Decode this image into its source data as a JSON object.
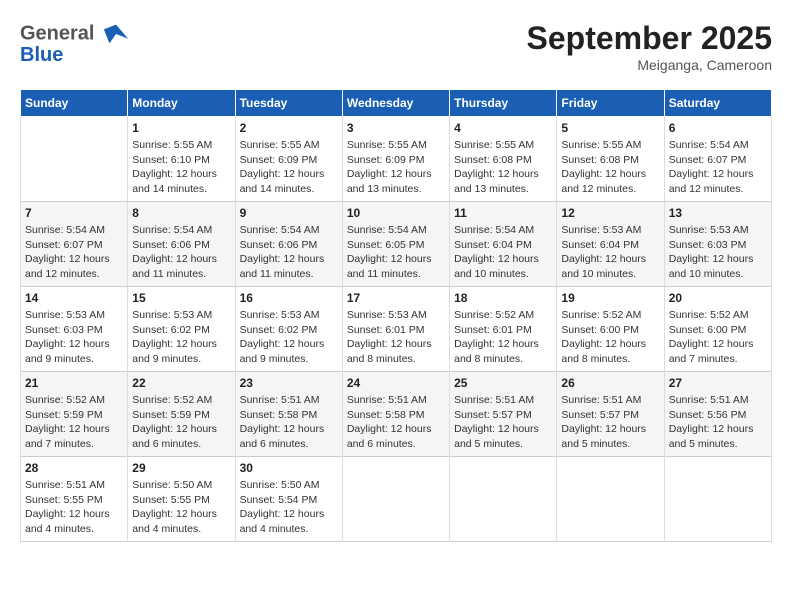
{
  "header": {
    "logo_line1": "General",
    "logo_line2": "Blue",
    "month": "September 2025",
    "location": "Meiganga, Cameroon"
  },
  "days_of_week": [
    "Sunday",
    "Monday",
    "Tuesday",
    "Wednesday",
    "Thursday",
    "Friday",
    "Saturday"
  ],
  "weeks": [
    [
      {
        "day": "",
        "info": ""
      },
      {
        "day": "1",
        "info": "Sunrise: 5:55 AM\nSunset: 6:10 PM\nDaylight: 12 hours\nand 14 minutes."
      },
      {
        "day": "2",
        "info": "Sunrise: 5:55 AM\nSunset: 6:09 PM\nDaylight: 12 hours\nand 14 minutes."
      },
      {
        "day": "3",
        "info": "Sunrise: 5:55 AM\nSunset: 6:09 PM\nDaylight: 12 hours\nand 13 minutes."
      },
      {
        "day": "4",
        "info": "Sunrise: 5:55 AM\nSunset: 6:08 PM\nDaylight: 12 hours\nand 13 minutes."
      },
      {
        "day": "5",
        "info": "Sunrise: 5:55 AM\nSunset: 6:08 PM\nDaylight: 12 hours\nand 12 minutes."
      },
      {
        "day": "6",
        "info": "Sunrise: 5:54 AM\nSunset: 6:07 PM\nDaylight: 12 hours\nand 12 minutes."
      }
    ],
    [
      {
        "day": "7",
        "info": "Sunrise: 5:54 AM\nSunset: 6:07 PM\nDaylight: 12 hours\nand 12 minutes."
      },
      {
        "day": "8",
        "info": "Sunrise: 5:54 AM\nSunset: 6:06 PM\nDaylight: 12 hours\nand 11 minutes."
      },
      {
        "day": "9",
        "info": "Sunrise: 5:54 AM\nSunset: 6:06 PM\nDaylight: 12 hours\nand 11 minutes."
      },
      {
        "day": "10",
        "info": "Sunrise: 5:54 AM\nSunset: 6:05 PM\nDaylight: 12 hours\nand 11 minutes."
      },
      {
        "day": "11",
        "info": "Sunrise: 5:54 AM\nSunset: 6:04 PM\nDaylight: 12 hours\nand 10 minutes."
      },
      {
        "day": "12",
        "info": "Sunrise: 5:53 AM\nSunset: 6:04 PM\nDaylight: 12 hours\nand 10 minutes."
      },
      {
        "day": "13",
        "info": "Sunrise: 5:53 AM\nSunset: 6:03 PM\nDaylight: 12 hours\nand 10 minutes."
      }
    ],
    [
      {
        "day": "14",
        "info": "Sunrise: 5:53 AM\nSunset: 6:03 PM\nDaylight: 12 hours\nand 9 minutes."
      },
      {
        "day": "15",
        "info": "Sunrise: 5:53 AM\nSunset: 6:02 PM\nDaylight: 12 hours\nand 9 minutes."
      },
      {
        "day": "16",
        "info": "Sunrise: 5:53 AM\nSunset: 6:02 PM\nDaylight: 12 hours\nand 9 minutes."
      },
      {
        "day": "17",
        "info": "Sunrise: 5:53 AM\nSunset: 6:01 PM\nDaylight: 12 hours\nand 8 minutes."
      },
      {
        "day": "18",
        "info": "Sunrise: 5:52 AM\nSunset: 6:01 PM\nDaylight: 12 hours\nand 8 minutes."
      },
      {
        "day": "19",
        "info": "Sunrise: 5:52 AM\nSunset: 6:00 PM\nDaylight: 12 hours\nand 8 minutes."
      },
      {
        "day": "20",
        "info": "Sunrise: 5:52 AM\nSunset: 6:00 PM\nDaylight: 12 hours\nand 7 minutes."
      }
    ],
    [
      {
        "day": "21",
        "info": "Sunrise: 5:52 AM\nSunset: 5:59 PM\nDaylight: 12 hours\nand 7 minutes."
      },
      {
        "day": "22",
        "info": "Sunrise: 5:52 AM\nSunset: 5:59 PM\nDaylight: 12 hours\nand 6 minutes."
      },
      {
        "day": "23",
        "info": "Sunrise: 5:51 AM\nSunset: 5:58 PM\nDaylight: 12 hours\nand 6 minutes."
      },
      {
        "day": "24",
        "info": "Sunrise: 5:51 AM\nSunset: 5:58 PM\nDaylight: 12 hours\nand 6 minutes."
      },
      {
        "day": "25",
        "info": "Sunrise: 5:51 AM\nSunset: 5:57 PM\nDaylight: 12 hours\nand 5 minutes."
      },
      {
        "day": "26",
        "info": "Sunrise: 5:51 AM\nSunset: 5:57 PM\nDaylight: 12 hours\nand 5 minutes."
      },
      {
        "day": "27",
        "info": "Sunrise: 5:51 AM\nSunset: 5:56 PM\nDaylight: 12 hours\nand 5 minutes."
      }
    ],
    [
      {
        "day": "28",
        "info": "Sunrise: 5:51 AM\nSunset: 5:55 PM\nDaylight: 12 hours\nand 4 minutes."
      },
      {
        "day": "29",
        "info": "Sunrise: 5:50 AM\nSunset: 5:55 PM\nDaylight: 12 hours\nand 4 minutes."
      },
      {
        "day": "30",
        "info": "Sunrise: 5:50 AM\nSunset: 5:54 PM\nDaylight: 12 hours\nand 4 minutes."
      },
      {
        "day": "",
        "info": ""
      },
      {
        "day": "",
        "info": ""
      },
      {
        "day": "",
        "info": ""
      },
      {
        "day": "",
        "info": ""
      }
    ]
  ]
}
